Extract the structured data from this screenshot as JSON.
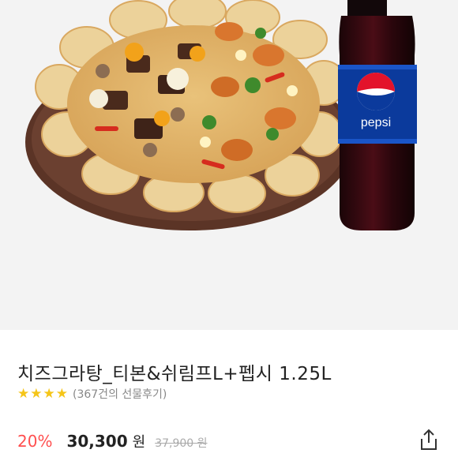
{
  "product": {
    "title": "치즈그라탕_티본&쉬림프L+펩시 1.25L",
    "rating_stars": 4,
    "review_text": "(367건의 선물후기)",
    "discount": "20%",
    "price": "30,300",
    "currency": "원",
    "original_price": "37,900 원"
  },
  "image": {
    "bottle_brand": "pepsi",
    "colors": {
      "background": "#f3f3f3",
      "discount": "#ff4f4f",
      "star": "#f5c518",
      "pepsi_blue": "#0b3a9c"
    }
  },
  "icons": {
    "share": "share-icon",
    "star": "star-icon"
  }
}
